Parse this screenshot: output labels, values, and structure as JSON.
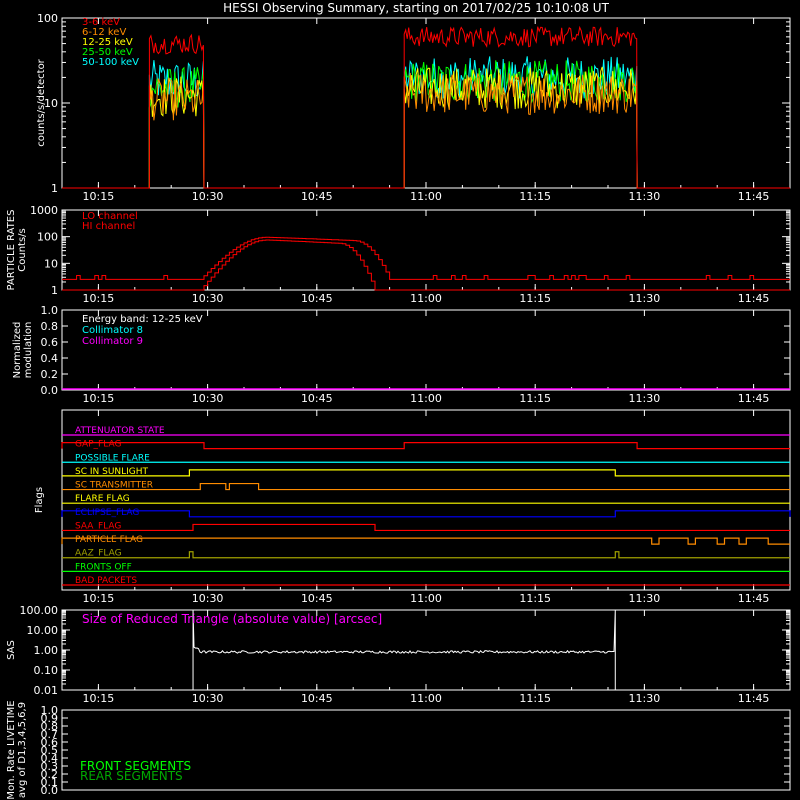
{
  "title": "HESSI Observing Summary, starting on 2017/02/25 10:10:08 UT",
  "colors": {
    "background": "#000000",
    "axis": "#ffffff",
    "red": "#ff0000",
    "orange": "#ff8c00",
    "yellow": "#ffff00",
    "green": "#00ff00",
    "cyan": "#00ffff",
    "magenta": "#ff00ff",
    "blue": "#0000ff",
    "olive": "#a0a000",
    "darkgreen": "#00aa00"
  },
  "chart_data": [
    {
      "id": "rates",
      "type": "line",
      "ylabel": "counts/s/detector",
      "yscale": "log",
      "ylim": [
        1,
        100
      ],
      "xlim": [
        "10:10",
        "11:50"
      ],
      "x_ticks": [
        "10:15",
        "10:30",
        "10:45",
        "11:00",
        "11:15",
        "11:30",
        "11:45"
      ],
      "y_ticks": [
        "1",
        "10",
        "100"
      ],
      "legend_placement": "top-left",
      "series": [
        {
          "name": "3-6 keV",
          "color": "red",
          "segments": [
            {
              "start": "10:22",
              "end": "10:29.5",
              "level": 50
            },
            {
              "start": "10:57",
              "end": "11:29",
              "level": 60
            }
          ]
        },
        {
          "name": "6-12 keV",
          "color": "orange",
          "segments": [
            {
              "start": "10:22",
              "end": "10:29.5",
              "level": 11
            },
            {
              "start": "10:57",
              "end": "11:29",
              "level": 13
            }
          ]
        },
        {
          "name": "12-25 keV",
          "color": "yellow",
          "segments": [
            {
              "start": "10:22",
              "end": "10:29.5",
              "level": 12
            },
            {
              "start": "10:57",
              "end": "11:29",
              "level": 15
            }
          ]
        },
        {
          "name": "25-50 keV",
          "color": "green",
          "segments": [
            {
              "start": "10:22",
              "end": "10:29.5",
              "level": 15
            },
            {
              "start": "10:57",
              "end": "11:29",
              "level": 18
            }
          ]
        },
        {
          "name": "50-100 keV",
          "color": "cyan",
          "segments": [
            {
              "start": "10:22",
              "end": "10:29.5",
              "level": 18
            },
            {
              "start": "10:57",
              "end": "11:29",
              "level": 20
            }
          ]
        }
      ]
    },
    {
      "id": "particle",
      "type": "line",
      "ylabel_lines": [
        "PARTICLE RATES",
        "Counts/s"
      ],
      "yscale": "log",
      "ylim": [
        1,
        1000
      ],
      "xlim": [
        "10:10",
        "11:50"
      ],
      "x_ticks": [
        "10:15",
        "10:30",
        "10:45",
        "11:00",
        "11:15",
        "11:30",
        "11:45"
      ],
      "y_ticks": [
        "1",
        "10",
        "100",
        "1000"
      ],
      "series": [
        {
          "name": "LO channel",
          "color": "red",
          "baseline": 2.5,
          "peak": 95,
          "rise_start": "10:29",
          "rise_end": "10:38",
          "fall_start": "10:50",
          "fall_end": "10:55"
        },
        {
          "name": "HI channel",
          "color": "red",
          "baseline": 1,
          "peak": 75,
          "rise_start": "10:29",
          "rise_end": "10:38",
          "fall_start": "10:48",
          "fall_end": "10:53"
        }
      ]
    },
    {
      "id": "modulation",
      "type": "line",
      "ylabel_lines": [
        "Normalized",
        "modulation"
      ],
      "ylim": [
        0,
        1
      ],
      "xlim": [
        "10:10",
        "11:50"
      ],
      "x_ticks": [
        "10:15",
        "10:30",
        "10:45",
        "11:00",
        "11:15",
        "11:30",
        "11:45"
      ],
      "y_ticks": [
        "0.0",
        "0.2",
        "0.4",
        "0.6",
        "0.8",
        "1.0"
      ],
      "energy_band_label": "Energy band: 12-25 keV",
      "series": [
        {
          "name": "Collimator 8",
          "color": "cyan",
          "values": []
        },
        {
          "name": "Collimator 9",
          "color": "magenta",
          "values": [
            0
          ]
        }
      ]
    },
    {
      "id": "flags",
      "type": "line",
      "ylabel": "Flags",
      "xlim": [
        "10:10",
        "11:50"
      ],
      "x_ticks": [
        "10:15",
        "10:30",
        "10:45",
        "11:00",
        "11:15",
        "11:30",
        "11:45"
      ],
      "series": [
        {
          "name": "ATTENUATOR STATE",
          "color": "magenta",
          "high": [],
          "low_level": true
        },
        {
          "name": "GAP_FLAG",
          "color": "red",
          "high": [
            [
              "10:10",
              "10:29.5"
            ],
            [
              "10:57",
              "11:29"
            ]
          ]
        },
        {
          "name": "POSSIBLE FLARE",
          "color": "cyan",
          "high": [],
          "low_level": true
        },
        {
          "name": "SC IN SUNLIGHT",
          "color": "yellow",
          "high": [
            [
              "10:27.5",
              "11:26"
            ]
          ]
        },
        {
          "name": "SC TRANSMITTER",
          "color": "orange",
          "high": [
            [
              "10:29",
              "10:32.5"
            ],
            [
              "10:33",
              "10:37"
            ]
          ]
        },
        {
          "name": "FLARE FLAG",
          "color": "yellow",
          "high": [],
          "low_level": true
        },
        {
          "name": "ECLIPSE_FLAG",
          "color": "blue",
          "high": [
            [
              "10:10",
              "10:27.5"
            ],
            [
              "11:26",
              "11:50"
            ]
          ]
        },
        {
          "name": "SAA_FLAG",
          "color": "red",
          "high": [
            [
              "10:28",
              "10:53"
            ]
          ]
        },
        {
          "name": "PARTICLE FLAG",
          "color": "orange",
          "high": [
            [
              "10:10",
              "11:31"
            ],
            [
              "11:32",
              "11:36"
            ],
            [
              "11:37",
              "11:40"
            ],
            [
              "11:41",
              "11:43"
            ],
            [
              "11:44",
              "11:47"
            ]
          ]
        },
        {
          "name": "AAZ_FLAG",
          "color": "olive",
          "high": [
            [
              "10:27.5",
              "10:28"
            ],
            [
              "11:26",
              "11:26.5"
            ]
          ]
        },
        {
          "name": "FRONTS OFF",
          "color": "green",
          "high": [],
          "low_level": true
        },
        {
          "name": "BAD PACKETS",
          "color": "red",
          "high": [],
          "low_level": true
        }
      ]
    },
    {
      "id": "sas",
      "type": "line",
      "ylabel": "SAS",
      "yscale": "log",
      "ylim": [
        0.01,
        100
      ],
      "xlim": [
        "10:10",
        "11:50"
      ],
      "x_ticks": [
        "10:15",
        "10:30",
        "10:45",
        "11:00",
        "11:15",
        "11:30",
        "11:45"
      ],
      "y_ticks": [
        "0.01",
        "0.10",
        "1.00",
        "10.00",
        "100.00"
      ],
      "annotation": "Size of Reduced Triangle (absolute value) [arcsec]",
      "series": [
        {
          "name": "",
          "color": "white",
          "start": "10:28",
          "end": "11:26",
          "level": 0.8,
          "spike_value": 100
        }
      ]
    },
    {
      "id": "livetime",
      "type": "line",
      "ylabel_lines": [
        "Mon. Rate LIVETIME",
        "avg of D1,3,4,5,6,9"
      ],
      "ylim": [
        0,
        1
      ],
      "xlim": [
        "10:10",
        "11:50"
      ],
      "y_ticks": [
        "0.0",
        "0.1",
        "0.2",
        "0.3",
        "0.4",
        "0.5",
        "0.6",
        "0.7",
        "0.8",
        "0.9",
        "1.0"
      ],
      "series": [
        {
          "name": "FRONT SEGMENTS",
          "color": "green",
          "values": []
        },
        {
          "name": "REAR SEGMENTS",
          "color": "darkgreen",
          "values": []
        }
      ]
    }
  ]
}
